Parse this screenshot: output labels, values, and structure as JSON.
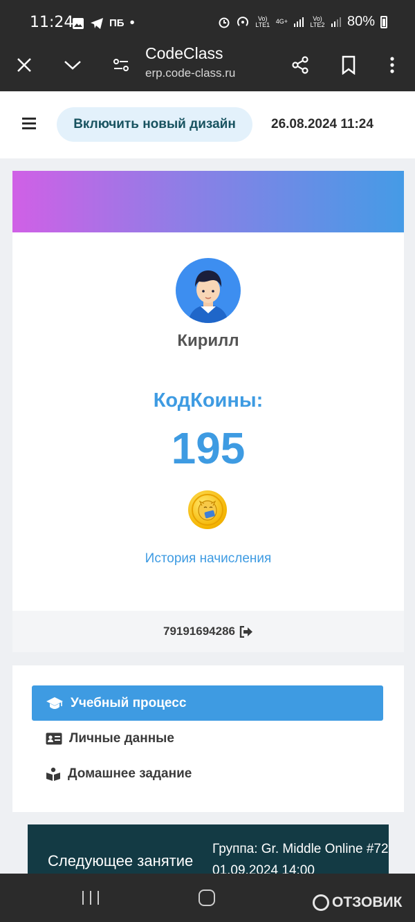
{
  "status_bar": {
    "time": "11:24",
    "notif_text": "ПБ",
    "battery": "80%",
    "volte1": "Vo) LTE1",
    "network": "4G+",
    "volte2": "Vo) LTE2"
  },
  "browser": {
    "title": "CodeClass",
    "url": "erp.code-class.ru",
    "icons": [
      "close-icon",
      "chevron-down-icon",
      "site-settings-icon",
      "share-icon",
      "bookmark-icon",
      "more-vert-icon"
    ]
  },
  "header": {
    "new_design_button": "Включить новый дизайн",
    "datetime": "26.08.2024 11:24"
  },
  "profile": {
    "name": "Кирилл",
    "coins_label": "КодКоины:",
    "coins_value": "195",
    "history_link": "История начисления",
    "phone": "79191694286",
    "banner_colors": [
      "#d060e6",
      "#459be6"
    ]
  },
  "menu": {
    "items": [
      {
        "label": "Учебный процесс",
        "icon": "graduation-cap-icon",
        "active": true
      },
      {
        "label": "Личные данные",
        "icon": "id-card-icon",
        "active": false
      },
      {
        "label": "Домашнее задание",
        "icon": "book-reader-icon",
        "active": false
      }
    ]
  },
  "next_lesson": {
    "label": "Следующее занятие",
    "group": "Группа: Gr. Middle Online #72",
    "date": "01.09.2024 14:00"
  },
  "watermark": "ОТЗОВИК",
  "colors": {
    "accent": "#3e9be2",
    "dark": "#2b2b2b",
    "lesson_bg": "#133a44"
  }
}
